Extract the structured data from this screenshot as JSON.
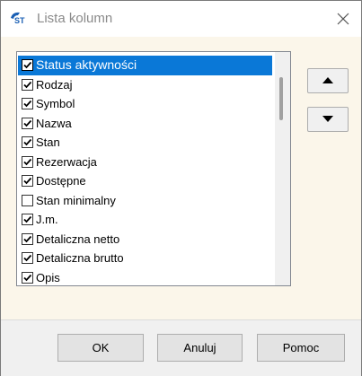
{
  "window": {
    "title": "Lista kolumn"
  },
  "columns": [
    {
      "label": "Status aktywności",
      "checked": true,
      "selected": true
    },
    {
      "label": "Rodzaj",
      "checked": true
    },
    {
      "label": "Symbol",
      "checked": true
    },
    {
      "label": "Nazwa",
      "checked": true
    },
    {
      "label": "Stan",
      "checked": true
    },
    {
      "label": "Rezerwacja",
      "checked": true
    },
    {
      "label": "Dostępne",
      "checked": true
    },
    {
      "label": "Stan minimalny",
      "checked": false
    },
    {
      "label": "J.m.",
      "checked": true
    },
    {
      "label": "Detaliczna netto",
      "checked": true
    },
    {
      "label": "Detaliczna brutto",
      "checked": true
    },
    {
      "label": "Opis",
      "checked": true
    }
  ],
  "buttons": {
    "ok": "OK",
    "cancel": "Anuluj",
    "help": "Pomoc"
  },
  "icons": {
    "app": "app-logo-icon",
    "close": "close-icon",
    "up": "arrow-up-icon",
    "down": "arrow-down-icon"
  },
  "colors": {
    "selection": "#0a78d7",
    "dialog_bg": "#fbf6ea"
  }
}
